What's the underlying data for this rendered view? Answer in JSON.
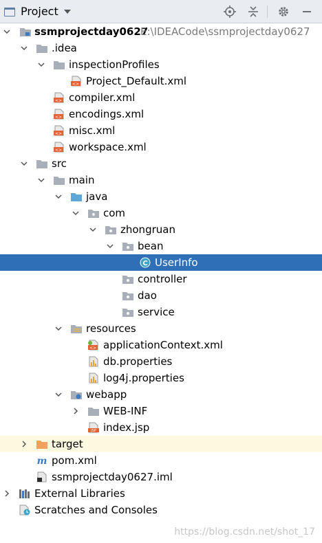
{
  "header": {
    "title": "Project",
    "buttons": [
      "locate-icon",
      "collapse-all-icon",
      "settings-gear-icon",
      "hide-panel-icon"
    ]
  },
  "tree": {
    "root_label": "ssmprojectday0627",
    "root_path": "E:\\IDEACode\\ssmprojectday0627",
    "idea": ".idea",
    "inspection_profiles": "inspectionProfiles",
    "project_default": "Project_Default.xml",
    "compiler": "compiler.xml",
    "encodings": "encodings.xml",
    "misc": "misc.xml",
    "workspace": "workspace.xml",
    "src": "src",
    "main": "main",
    "java": "java",
    "com": "com",
    "zhongruan": "zhongruan",
    "bean": "bean",
    "userinfo": "UserInfo",
    "controller": "controller",
    "dao": "dao",
    "service": "service",
    "resources": "resources",
    "application_context": "applicationContext.xml",
    "db_properties": "db.properties",
    "log4j_properties": "log4j.properties",
    "webapp": "webapp",
    "web_inf": "WEB-INF",
    "index_jsp": "index.jsp",
    "target": "target",
    "pom": "pom.xml",
    "iml": "ssmprojectday0627.iml",
    "external_libraries": "External Libraries",
    "scratches": "Scratches and Consoles"
  },
  "colors": {
    "selection": "#2f6fb8",
    "folder": "#a8afb8",
    "source_folder": "#5ea6d8",
    "excluded_folder": "#f0a15c",
    "xml_badge": "#e5612f",
    "header_bg": "#e9edf1"
  },
  "watermark": "https://blog.csdn.net/shot_17"
}
